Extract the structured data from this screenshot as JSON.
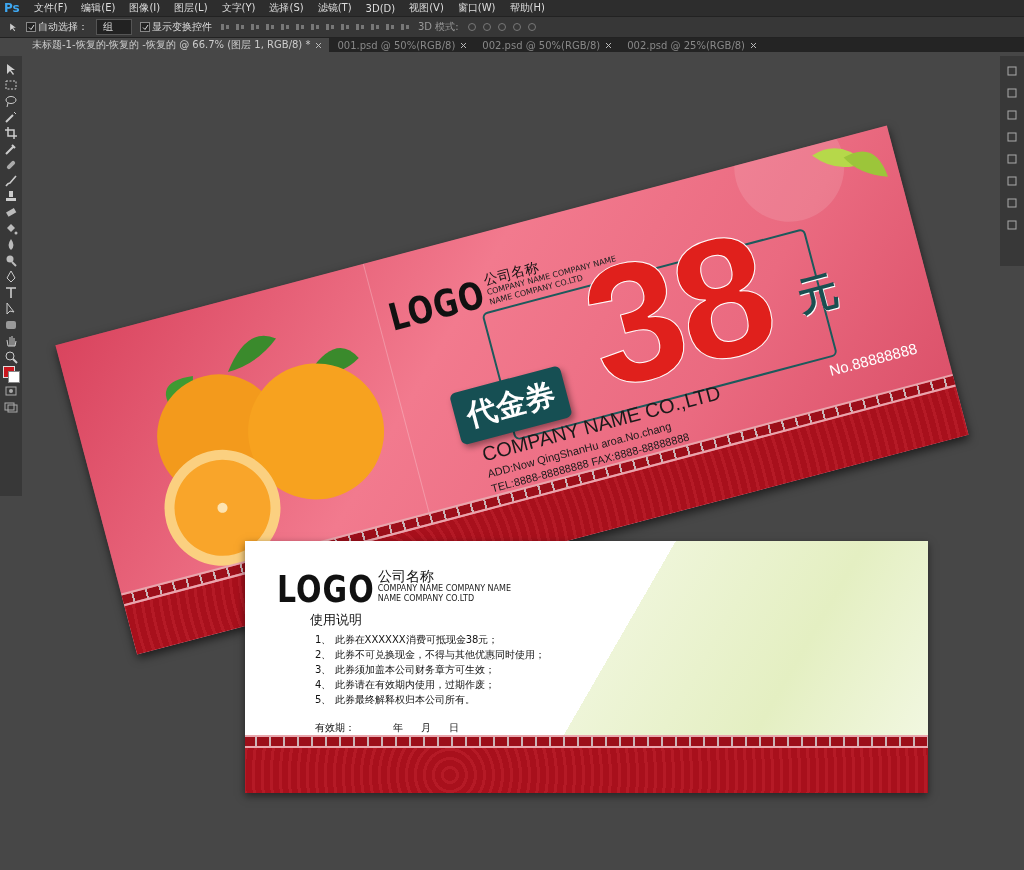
{
  "app_logo": "Ps",
  "menu": [
    "文件(F)",
    "编辑(E)",
    "图像(I)",
    "图层(L)",
    "文字(Y)",
    "选择(S)",
    "滤镜(T)",
    "3D(D)",
    "视图(V)",
    "窗口(W)",
    "帮助(H)"
  ],
  "options": {
    "auto_select": {
      "label": "自动选择：",
      "checked": true
    },
    "auto_select_target": "组",
    "show_transform": {
      "label": "显示变换控件",
      "checked": true
    },
    "mode_label": "3D 模式:"
  },
  "tabs": [
    {
      "label": "未标题-1-恢复的-恢复的 -恢复的 @ 66.7% (图层 1, RGB/8) *",
      "selected": true
    },
    {
      "label": "001.psd @ 50%(RGB/8)",
      "selected": false
    },
    {
      "label": "002.psd @ 50%(RGB/8)",
      "selected": false
    },
    {
      "label": "002.psd @ 25%(RGB/8)",
      "selected": false
    }
  ],
  "front_card": {
    "logo": "LOGO",
    "company_cn": "公司名称",
    "company_en_1": "COMPANY NAME COMPANY NAME",
    "company_en_2": "NAME COMPANY CO.LTD",
    "badge": "代金券",
    "amount": "38",
    "unit": "元",
    "company": "COMPANY NAME CO.,LTD",
    "address": "ADD:Now QingShanHu aroa.No.chang",
    "contact": "TEL:8888-88888888  FAX:8888-88888888",
    "serial": "No.88888888"
  },
  "back_card": {
    "logo": "LOGO",
    "company_cn": "公司名称",
    "company_en_1": "COMPANY NAME COMPANY NAME",
    "company_en_2": "NAME COMPANY CO.LTD",
    "title": "使用说明",
    "rules": [
      "1、 此券在XXXXXX消费可抵现金38元；",
      "2、 此券不可兑换现金，不得与其他优惠同时使用；",
      "3、 此券须加盖本公司财务章方可生效；",
      "4、 此券请在有效期内使用，过期作废；",
      "5、 此券最终解释权归本公司所有。"
    ],
    "validity_label": "有效期：",
    "year": "年",
    "month": "月",
    "day": "日"
  }
}
